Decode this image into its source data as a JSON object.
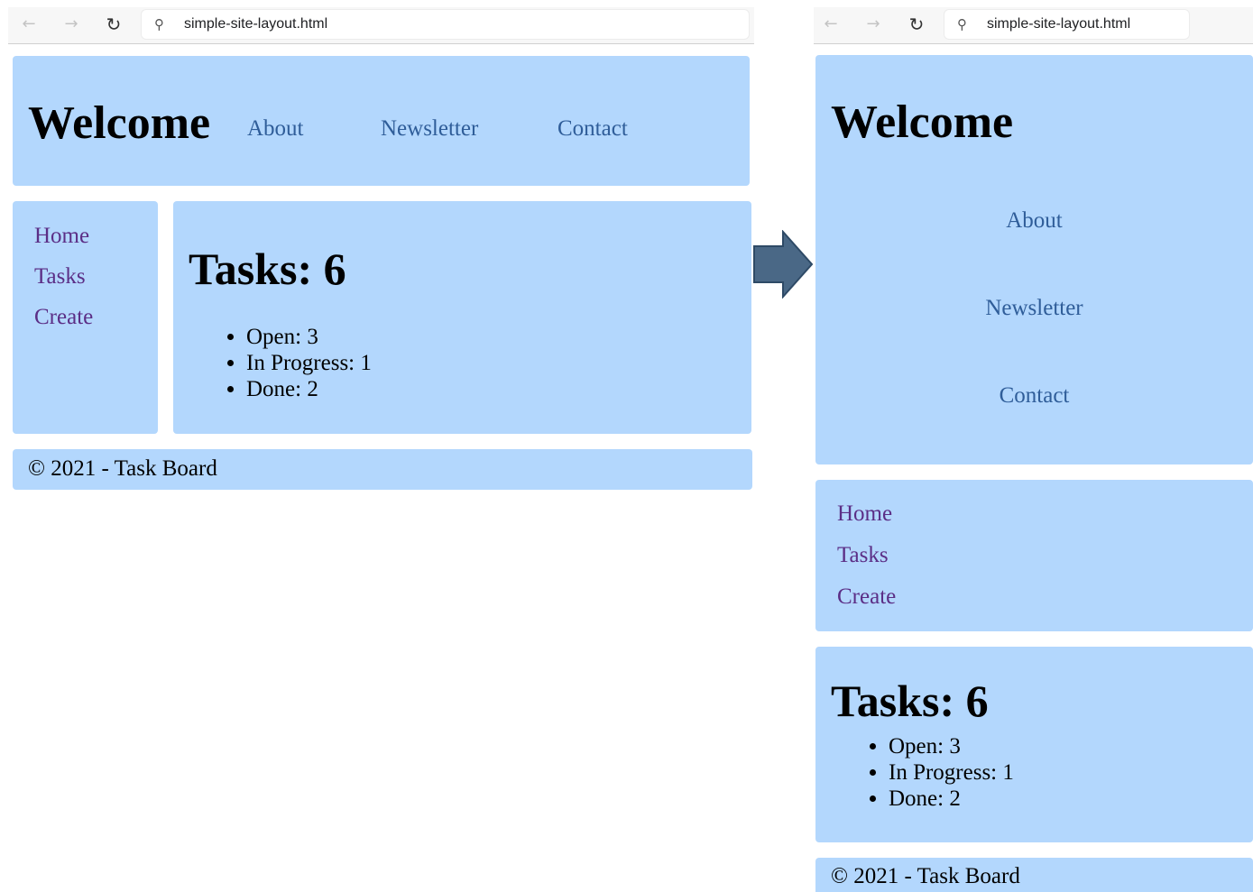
{
  "browser": {
    "url": "simple-site-layout.html",
    "back_icon": "arrow-left-icon",
    "forward_icon": "arrow-right-icon",
    "reload_icon": "reload-icon",
    "search_icon": "search-icon"
  },
  "header": {
    "title": "Welcome",
    "nav": [
      "About",
      "Newsletter",
      "Contact"
    ]
  },
  "sidebar": {
    "items": [
      "Home",
      "Tasks",
      "Create"
    ]
  },
  "main": {
    "title": "Tasks: 6",
    "statuses": [
      "Open: 3",
      "In Progress: 1",
      "Done: 2"
    ]
  },
  "footer": {
    "text": "© 2021 - Task Board"
  },
  "colors": {
    "panel": "#b3d7fd",
    "nav_link": "#2f5d99",
    "visited_link": "#5b2e86",
    "arrow": "#4a6886"
  }
}
